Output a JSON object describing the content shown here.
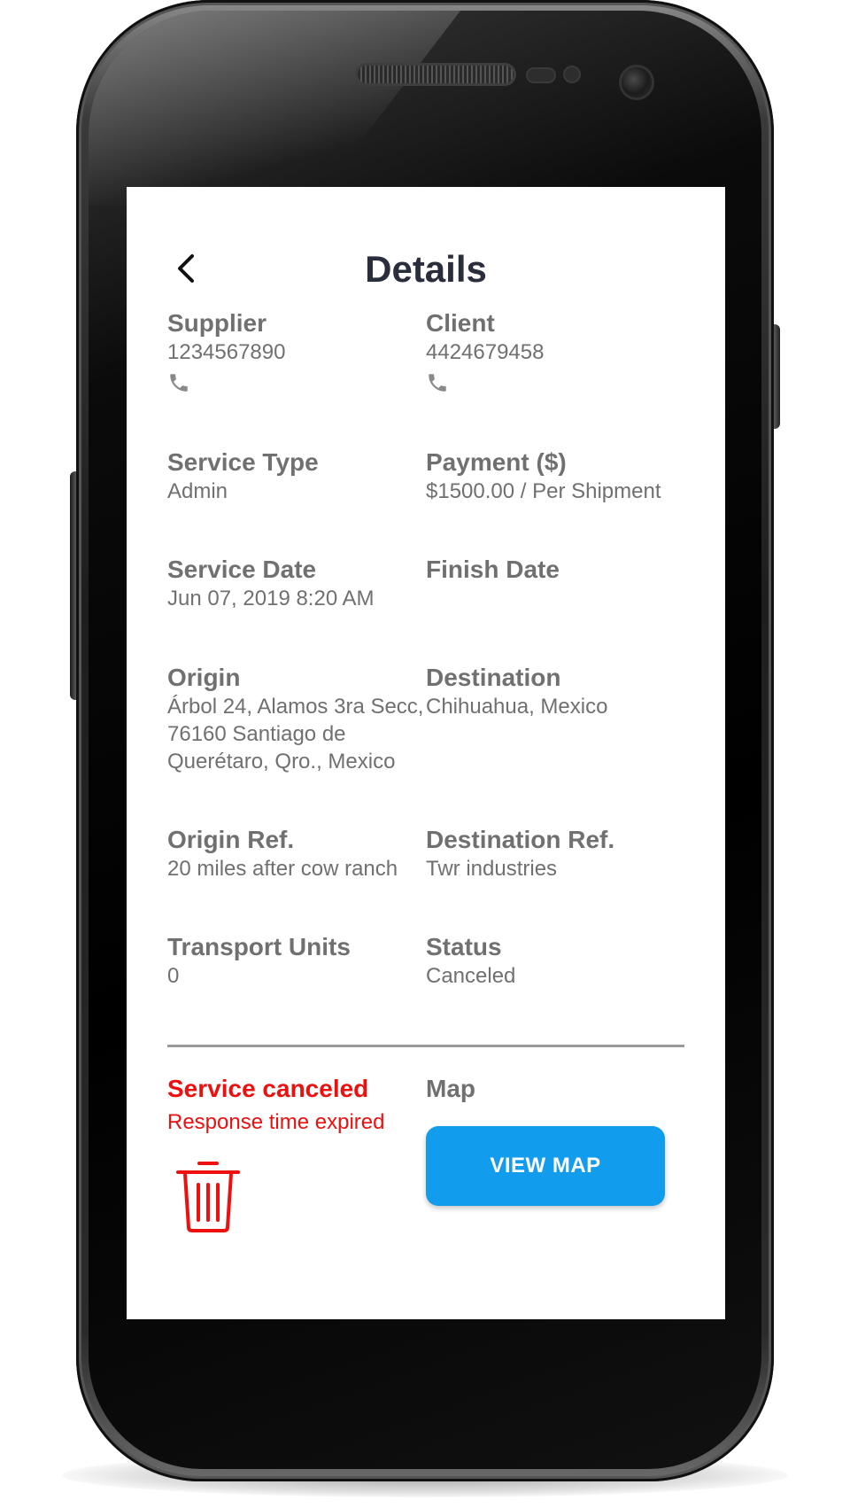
{
  "header": {
    "title": "Details",
    "back_icon": "chevron-left-icon"
  },
  "fields": {
    "supplier": {
      "label": "Supplier",
      "value": "1234567890",
      "icon": "phone-icon"
    },
    "client": {
      "label": "Client",
      "value": "4424679458",
      "icon": "phone-icon"
    },
    "service_type": {
      "label": "Service Type",
      "value": "Admin"
    },
    "payment": {
      "label": "Payment ($)",
      "value": "$1500.00 / Per Shipment"
    },
    "service_date": {
      "label": "Service Date",
      "value": "Jun 07, 2019 8:20 AM"
    },
    "finish_date": {
      "label": "Finish Date",
      "value": ""
    },
    "origin": {
      "label": "Origin",
      "value": "Árbol 24, Alamos 3ra Secc, 76160 Santiago de Querétaro, Qro., Mexico"
    },
    "destination": {
      "label": "Destination",
      "value": "Chihuahua, Mexico"
    },
    "origin_ref": {
      "label": "Origin Ref.",
      "value": "20 miles after cow ranch"
    },
    "destination_ref": {
      "label": "Destination Ref.",
      "value": "Twr industries"
    },
    "transport_units": {
      "label": "Transport Units",
      "value": "0"
    },
    "status": {
      "label": "Status",
      "value": "Canceled"
    }
  },
  "cancellation": {
    "title": "Service canceled",
    "reason": "Response time expired",
    "delete_icon": "trash-icon"
  },
  "map": {
    "label": "Map",
    "button_label": "VIEW MAP"
  },
  "colors": {
    "title": "#2a2d3c",
    "text": "#707070",
    "alert": "#ee0f0f",
    "primary_button": "#129cee"
  }
}
